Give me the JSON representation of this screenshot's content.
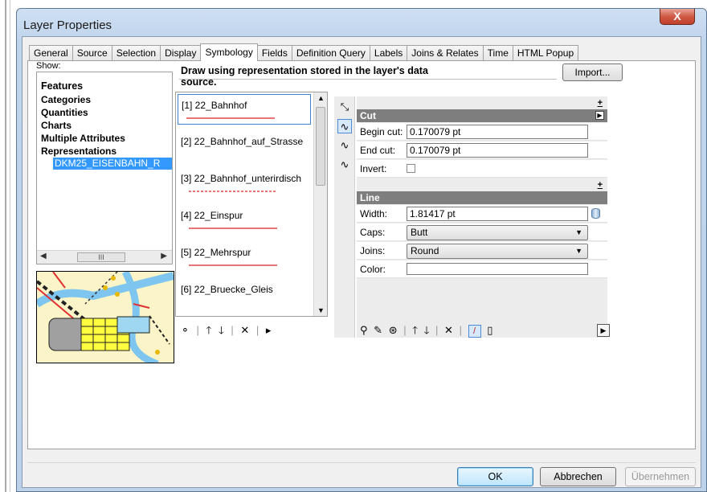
{
  "window": {
    "title": "Layer Properties",
    "close_label": "X"
  },
  "tabs": [
    {
      "label": "General"
    },
    {
      "label": "Source"
    },
    {
      "label": "Selection"
    },
    {
      "label": "Display"
    },
    {
      "label": "Symbology"
    },
    {
      "label": "Fields"
    },
    {
      "label": "Definition Query"
    },
    {
      "label": "Labels"
    },
    {
      "label": "Joins & Relates"
    },
    {
      "label": "Time"
    },
    {
      "label": "HTML Popup"
    }
  ],
  "active_tab": "Symbology",
  "show": {
    "label": "Show:",
    "items": [
      "Features",
      "Categories",
      "Quantities",
      "Charts",
      "Multiple Attributes",
      "Representations"
    ],
    "child": "DKM25_EISENBAHN_R",
    "scroll_thumb": "III"
  },
  "description": "Draw using representation stored in the layer's data source.",
  "import_button": "Import...",
  "rules": [
    {
      "label": "[1] 22_Bahnhof"
    },
    {
      "label": "[2] 22_Bahnhof_auf_Strasse"
    },
    {
      "label": "[3] 22_Bahnhof_unterirdisch"
    },
    {
      "label": "[4] 22_Einspur"
    },
    {
      "label": "[5] 22_Mehrspur"
    },
    {
      "label": "[6] 22_Bruecke_Gleis"
    }
  ],
  "cut_section": {
    "title": "Cut",
    "begin_label": "Begin cut:",
    "begin_value": "0.170079 pt",
    "end_label": "End cut:",
    "end_value": "0.170079 pt",
    "invert_label": "Invert:"
  },
  "line_section": {
    "title": "Line",
    "width_label": "Width:",
    "width_value": "1.81417 pt",
    "caps_label": "Caps:",
    "caps_value": "Butt",
    "joins_label": "Joins:",
    "joins_value": "Round",
    "color_label": "Color:"
  },
  "buttons": {
    "ok": "OK",
    "cancel": "Abbrechen",
    "apply": "Übernehmen"
  }
}
